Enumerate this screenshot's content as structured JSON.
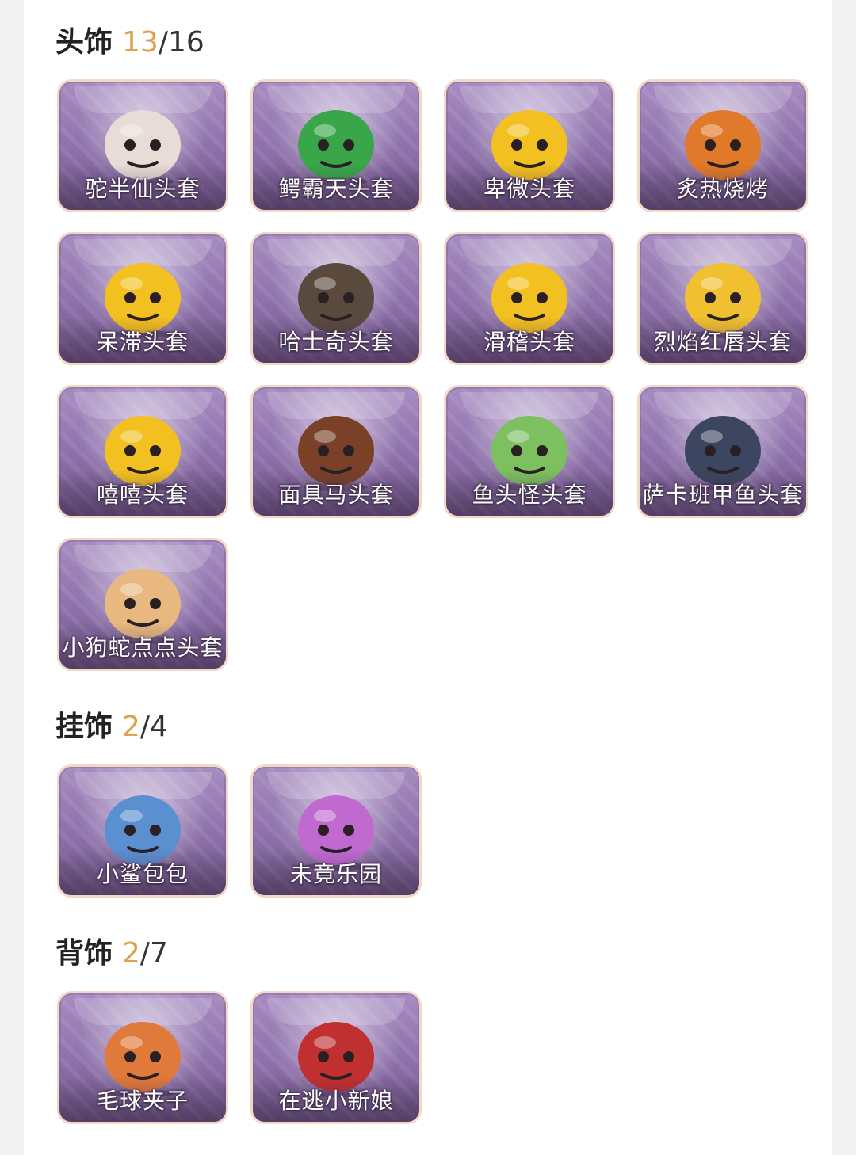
{
  "sections": [
    {
      "title": "头饰",
      "owned": "13",
      "total": "/16",
      "items": [
        {
          "name": "驼半仙头套",
          "icon": "raccoon-sunglasses-mask-icon",
          "color": "#e8dcd6"
        },
        {
          "name": "鳄霸天头套",
          "icon": "crocodile-mask-icon",
          "color": "#3aa64a"
        },
        {
          "name": "卑微头套",
          "icon": "worried-emoji-mask-icon",
          "color": "#f2c020"
        },
        {
          "name": "炙热烧烤",
          "icon": "grill-meat-mask-icon",
          "color": "#e07a2a"
        },
        {
          "name": "呆滞头套",
          "icon": "dazed-emoji-mask-icon",
          "color": "#f2c020"
        },
        {
          "name": "哈士奇头套",
          "icon": "husky-sunglasses-mask-icon",
          "color": "#5a4a3e"
        },
        {
          "name": "滑稽头套",
          "icon": "funny-emoji-mask-icon",
          "color": "#f2c020"
        },
        {
          "name": "烈焰红唇头套",
          "icon": "pikachu-sunglasses-mask-icon",
          "color": "#f0c030"
        },
        {
          "name": "嘻嘻头套",
          "icon": "grin-emoji-mask-icon",
          "color": "#f2c020"
        },
        {
          "name": "面具马头套",
          "icon": "horse-mask-icon",
          "color": "#7a4028"
        },
        {
          "name": "鱼头怪头套",
          "icon": "fish-head-mask-icon",
          "color": "#7cc060"
        },
        {
          "name": "萨卡班甲鱼头套",
          "icon": "armored-fish-mask-icon",
          "color": "#3c4660"
        },
        {
          "name": "小狗蛇点点头套",
          "icon": "snake-mask-icon",
          "color": "#e8b880"
        }
      ]
    },
    {
      "title": "挂饰",
      "owned": "2",
      "total": "/4",
      "items": [
        {
          "name": "小鲨包包",
          "icon": "shark-bag-icon",
          "color": "#5a8fd0"
        },
        {
          "name": "未竟乐园",
          "icon": "doll-charm-icon",
          "color": "#c06ad0"
        }
      ]
    },
    {
      "title": "背饰",
      "owned": "2",
      "total": "/7",
      "items": [
        {
          "name": "毛球夹子",
          "icon": "red-panda-clip-icon",
          "color": "#e07a3a"
        },
        {
          "name": "在逃小新娘",
          "icon": "red-veil-icon",
          "color": "#c03030"
        }
      ]
    }
  ]
}
